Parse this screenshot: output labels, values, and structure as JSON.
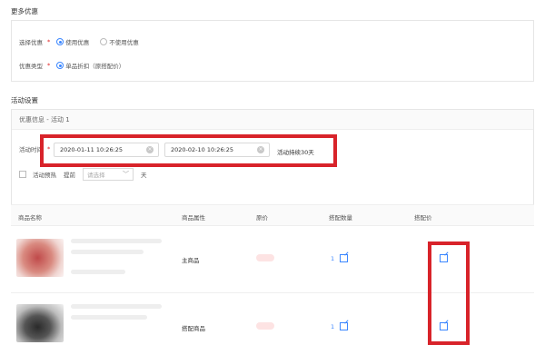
{
  "more_offers": {
    "title": "更多优惠",
    "select_label": "选择优惠",
    "use_label": "使用优惠",
    "no_use_label": "不使用优惠",
    "type_label": "优惠类型",
    "type_value": "单品折扣（原搭配价）"
  },
  "activity": {
    "title": "活动设置",
    "info_header": "优惠信息 - 活动 1",
    "time_label": "活动时间",
    "start": "2020-01-11 10:26:25",
    "end": "2020-02-10 10:26:25",
    "duration": "活动持续30天",
    "preheat_label": "活动预热",
    "advance_label": "提前",
    "select_placeholder": "请选择",
    "day_unit": "天"
  },
  "table": {
    "headers": [
      "商品名称",
      "商品属性",
      "原价",
      "搭配数量",
      "搭配价"
    ],
    "rows": [
      {
        "attr": "主商品",
        "qty": "1"
      },
      {
        "attr": "搭配商品",
        "qty": "1"
      }
    ]
  },
  "colors": {
    "accent": "#3a86ff",
    "required": "#e02020",
    "highlight": "#d8232a"
  },
  "icons": [
    "clear-icon",
    "chevron-down-icon",
    "edit-icon"
  ]
}
